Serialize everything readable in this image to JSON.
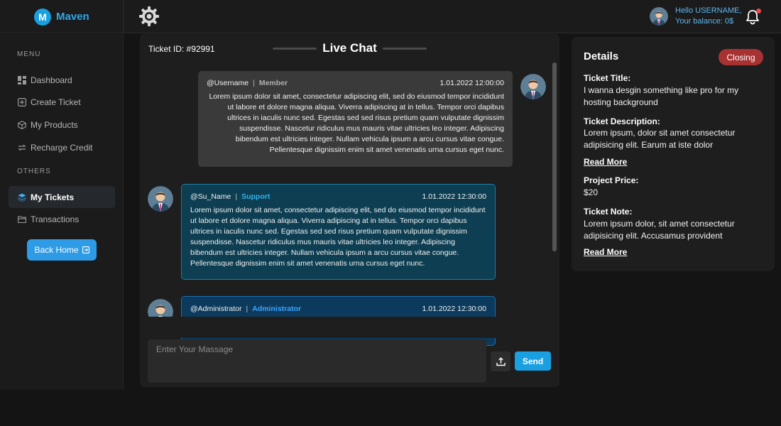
{
  "brand": {
    "logo_letter": "M",
    "name": "Maven",
    "accent": "#1aa0e0"
  },
  "header": {
    "settings_icon": "gear-icon",
    "greeting": "Hello USERNAME,",
    "balance": "Your balance: 0$",
    "notification_icon": "bell-icon"
  },
  "sidebar": {
    "menu_label": "MENU",
    "menu_items": [
      {
        "label": "Dashboard",
        "icon": "dashboard-icon"
      },
      {
        "label": "Create Ticket",
        "icon": "plus-square-icon"
      },
      {
        "label": "My Products",
        "icon": "box-icon"
      },
      {
        "label": "Recharge Credit",
        "icon": "refresh-icon"
      }
    ],
    "others_label": "OTHERS",
    "other_items": [
      {
        "label": "My Tickets",
        "icon": "layers-icon",
        "active": true
      },
      {
        "label": "Transactions",
        "icon": "folder-icon"
      }
    ],
    "back_home": "Back Home"
  },
  "chat": {
    "ticket_id": "Ticket ID: #92991",
    "title": "Live Chat",
    "messages": [
      {
        "user": "@Username",
        "role": "Member",
        "time": "1.01.2022 12:00:00",
        "text": "Lorem ipsum dolor sit amet, consectetur adipiscing elit, sed do eiusmod tempor incididunt ut labore et dolore magna aliqua. Viverra adipiscing at in tellus. Tempor orci dapibus ultrices in iaculis nunc sed. Egestas sed sed risus pretium quam vulputate dignissim suspendisse. Nascetur ridiculus mus mauris vitae ultricies leo integer. Adipiscing bibendum est ultricies integer. Nullam vehicula ipsum a arcu cursus vitae congue. Pellentesque dignissim enim sit amet venenatis urna cursus eget nunc."
      },
      {
        "user": "@Su_Name",
        "role": "Support",
        "time": "1.01.2022 12:30:00",
        "text": "Lorem ipsum dolor sit amet, consectetur adipiscing elit, sed do eiusmod tempor incididunt ut labore et dolore magna aliqua. Viverra adipiscing at in tellus. Tempor orci dapibus ultrices in iaculis nunc sed. Egestas sed sed risus pretium quam vulputate dignissim suspendisse. Nascetur ridiculus mus mauris vitae ultricies leo integer. Adipiscing bibendum est ultricies integer. Nullam vehicula ipsum a arcu cursus vitae congue. Pellentesque dignissim enim sit amet venenatis urna cursus eget nunc."
      },
      {
        "user": "@Administrator",
        "role": "Administrator",
        "time": "1.01.2022 12:30:00"
      }
    ],
    "input_placeholder": "Enter Your Massage",
    "upload_icon": "upload-icon",
    "send_label": "Send"
  },
  "details": {
    "title": "Details",
    "status": "Closing",
    "status_color": "#a83232",
    "ticket_title_label": "Ticket Title:",
    "ticket_title": "I wanna desgin something like pro for my hosting background",
    "description_label": "Ticket Description:",
    "description": "Lorem ipsum, dolor sit amet consectetur adipisicing elit. Earum at iste dolor",
    "read_more_1": "Read More",
    "price_label": "Project Price:",
    "price": "$20",
    "note_label": "Ticket Note:",
    "note": "Lorem ipsum dolor, sit amet consectetur adipisicing elit. Accusamus provident",
    "read_more_2": "Read More"
  }
}
